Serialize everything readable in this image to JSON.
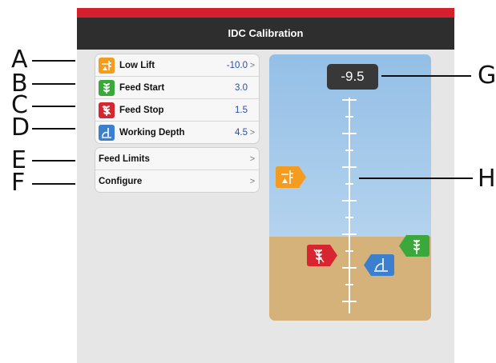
{
  "callouts": [
    "A",
    "B",
    "C",
    "D",
    "E",
    "F",
    "G",
    "H"
  ],
  "title": "IDC Calibration",
  "settings": [
    {
      "label": "Low Lift",
      "value": "-10.0",
      "chevron": ">",
      "icon": "low-lift-icon",
      "color": "#f39c1f"
    },
    {
      "label": "Feed Start",
      "value": "3.0",
      "chevron": "",
      "icon": "feed-start-icon",
      "color": "#3aa83a"
    },
    {
      "label": "Feed Stop",
      "value": "1.5",
      "chevron": "",
      "icon": "feed-stop-icon",
      "color": "#d7262f"
    },
    {
      "label": "Working Depth",
      "value": "4.5",
      "chevron": ">",
      "icon": "working-depth-icon",
      "color": "#3d7fcf"
    }
  ],
  "menu": [
    {
      "label": "Feed Limits",
      "chevron": ">"
    },
    {
      "label": "Configure",
      "chevron": ">"
    }
  ],
  "depth_readout": "-9.5",
  "colors": {
    "accent": "#d51f2c",
    "title_bar": "#2e2e2e",
    "sky": "#a9cdee",
    "ground": "#d6b27b"
  }
}
